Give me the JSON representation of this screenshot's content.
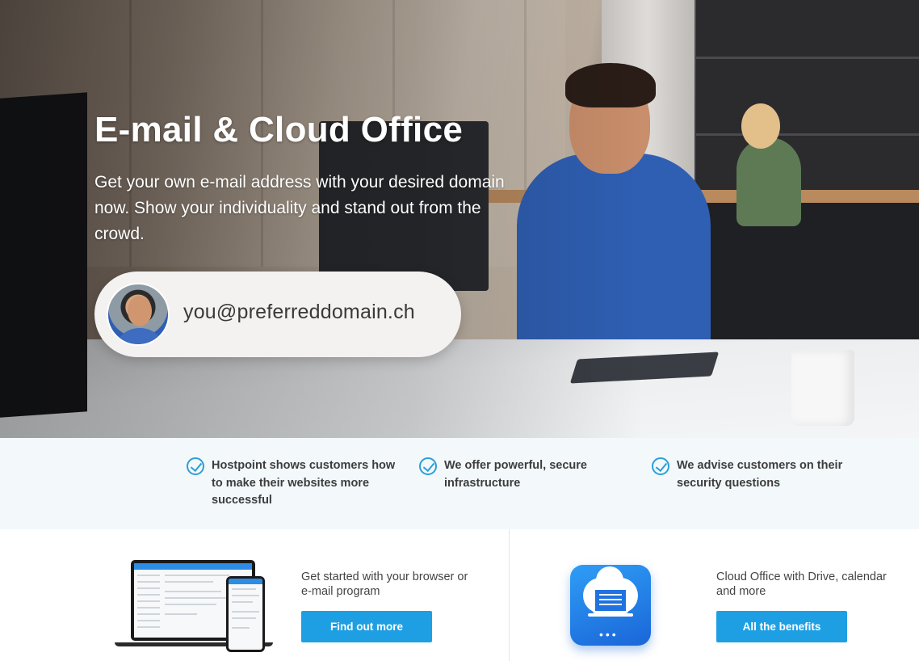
{
  "hero": {
    "title": "E-mail & Cloud Office",
    "subtitle": "Get your own e-mail address with your desired domain now. Show your individuality and stand out from the crowd.",
    "email_example": "you@preferreddomain.ch"
  },
  "features": [
    {
      "text": "Hostpoint shows customers how to make their websites more successful",
      "icon": "check-circle-icon"
    },
    {
      "text": "We offer powerful, secure infrastructure",
      "icon": "check-circle-icon"
    },
    {
      "text": "We advise customers on their security questions",
      "icon": "check-circle-icon"
    }
  ],
  "cards": {
    "email": {
      "description": "Get started with your browser or e-mail program",
      "button_label": "Find out more",
      "icon": "devices-icon"
    },
    "cloud": {
      "description": "Cloud Office with Drive, calendar and more",
      "button_label": "All the benefits",
      "icon": "cloud-office-icon"
    }
  },
  "colors": {
    "accent": "#1f9fe3",
    "check": "#2a9fd8",
    "strip_bg": "#f3f8fb"
  }
}
